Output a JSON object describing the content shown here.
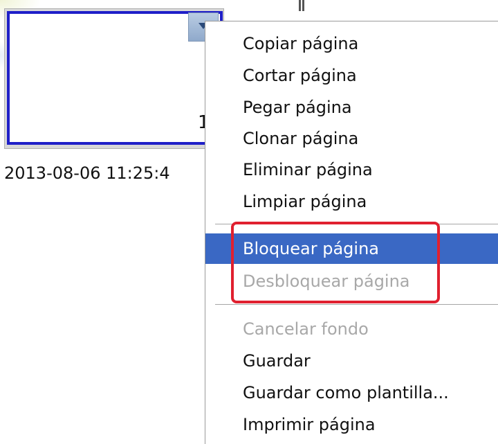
{
  "thumbnail": {
    "page_number": "1",
    "timestamp": "2013-08-06 11:25:4"
  },
  "context_menu": {
    "items": [
      {
        "label": "Copiar página",
        "enabled": true
      },
      {
        "label": "Cortar página",
        "enabled": true
      },
      {
        "label": "Pegar página",
        "enabled": true
      },
      {
        "label": "Clonar página",
        "enabled": true
      },
      {
        "label": "Eliminar página",
        "enabled": true
      },
      {
        "label": "Limpiar página",
        "enabled": true
      },
      {
        "label": "Bloquear página",
        "enabled": true,
        "selected": true
      },
      {
        "label": "Desbloquear página",
        "enabled": false
      },
      {
        "label": "Cancelar fondo",
        "enabled": false
      },
      {
        "label": "Guardar",
        "enabled": true
      },
      {
        "label": "Guardar como plantilla...",
        "enabled": true
      },
      {
        "label": "Imprimir página",
        "enabled": true
      }
    ]
  },
  "colors": {
    "selection": "#3a68c4",
    "highlight_box": "#e0202f",
    "thumbnail_border": "#1f1fc8"
  }
}
